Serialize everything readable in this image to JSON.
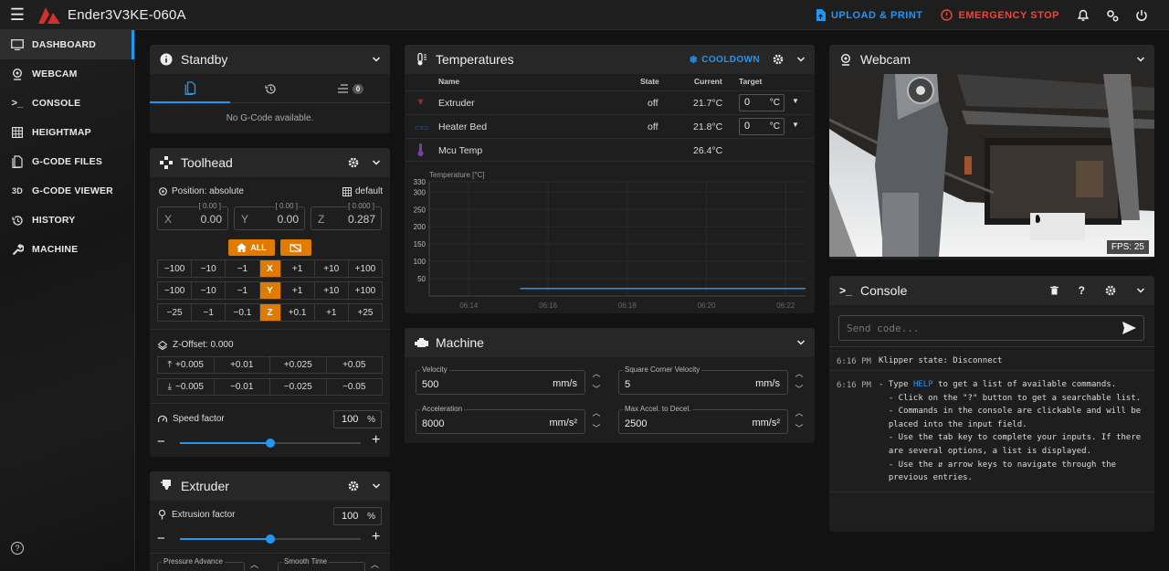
{
  "topbar": {
    "printer_name": "Ender3V3KE-060A",
    "upload_label": "UPLOAD & PRINT",
    "estop_label": "EMERGENCY STOP",
    "accent": "#2196f3",
    "danger": "#f44336"
  },
  "sidebar": {
    "items": [
      {
        "label": "DASHBOARD",
        "icon": "dashboard-icon"
      },
      {
        "label": "WEBCAM",
        "icon": "webcam-icon"
      },
      {
        "label": "CONSOLE",
        "icon": "console-icon"
      },
      {
        "label": "HEIGHTMAP",
        "icon": "grid-icon"
      },
      {
        "label": "G-CODE FILES",
        "icon": "file-icon"
      },
      {
        "label": "G-CODE VIEWER",
        "icon": "3d-icon"
      },
      {
        "label": "HISTORY",
        "icon": "history-icon"
      },
      {
        "label": "MACHINE",
        "icon": "wrench-icon"
      }
    ]
  },
  "standby": {
    "title": "Standby",
    "queue_count": "0",
    "empty_text": "No G-Code available."
  },
  "toolhead": {
    "title": "Toolhead",
    "position_label": "Position: absolute",
    "mesh_label": "default",
    "x": {
      "label": "X",
      "value": "0.00",
      "bracket": "[ 0.00 ]"
    },
    "y": {
      "label": "Y",
      "value": "0.00",
      "bracket": "[ 0.00 ]"
    },
    "z": {
      "label": "Z",
      "value": "0.287",
      "bracket": "[ 0.000 ]"
    },
    "home_all_label": "ALL",
    "x_row": [
      "−100",
      "−10",
      "−1",
      "X",
      "+1",
      "+10",
      "+100"
    ],
    "y_row": [
      "−100",
      "−10",
      "−1",
      "Y",
      "+1",
      "+10",
      "+100"
    ],
    "z_row": [
      "−25",
      "−1",
      "−0.1",
      "Z",
      "+0.1",
      "+1",
      "+25"
    ],
    "zoffset_label": "Z-Offset: 0.000",
    "zoff_up": [
      "+0.005",
      "+0.01",
      "+0.025",
      "+0.05"
    ],
    "zoff_down": [
      "−0.005",
      "−0.01",
      "−0.025",
      "−0.05"
    ],
    "speed_label": "Speed factor",
    "speed_value": "100",
    "speed_unit": "%",
    "speed_fraction": 0.5
  },
  "extruder": {
    "title": "Extruder",
    "factor_label": "Extrusion factor",
    "factor_value": "100",
    "factor_unit": "%",
    "factor_fraction": 0.5,
    "pressure_label": "Pressure Advance",
    "smooth_label": "Smooth Time"
  },
  "temperatures": {
    "title": "Temperatures",
    "cooldown_label": "COOLDOWN",
    "headers": {
      "name": "Name",
      "state": "State",
      "current": "Current",
      "target": "Target"
    },
    "rows": [
      {
        "name": "Extruder",
        "state": "off",
        "current": "21.7°C",
        "target": "0",
        "unit": "°C",
        "icon": "nozzle-icon"
      },
      {
        "name": "Heater Bed",
        "state": "off",
        "current": "21.8°C",
        "target": "0",
        "unit": "°C",
        "icon": "bed-icon"
      },
      {
        "name": "Mcu Temp",
        "state": "",
        "current": "26.4°C",
        "target": "",
        "unit": "",
        "icon": "thermometer-icon"
      }
    ]
  },
  "chart_data": {
    "type": "line",
    "title": "",
    "ylabel": "Temperature [°C]",
    "xlabel": "",
    "ylim": [
      0,
      330
    ],
    "yticks": [
      "330",
      "300",
      "250",
      "200",
      "150",
      "100",
      "50"
    ],
    "x": [
      "06:14",
      "06:16",
      "06:18",
      "06:20",
      "06:22"
    ],
    "series": [
      {
        "color": "#9c6ade",
        "x_start": "06:15.3",
        "values": [
          21.7,
          21.7
        ]
      },
      {
        "color": "#2196f3",
        "x_start": "06:15.3",
        "values": [
          21.8,
          21.8
        ]
      }
    ]
  },
  "machine": {
    "title": "Machine",
    "velocity_label": "Velocity",
    "velocity_value": "500",
    "velocity_unit": "mm/s",
    "scv_label": "Square Corner Velocity",
    "scv_value": "5",
    "scv_unit": "mm/s",
    "accel_label": "Acceleration",
    "accel_value": "8000",
    "accel_unit": "mm/s²",
    "decel_label": "Max Accel. to Decel.",
    "decel_value": "2500",
    "decel_unit": "mm/s²"
  },
  "webcam": {
    "title": "Webcam",
    "fps_label": "FPS: 25"
  },
  "console": {
    "title": "Console",
    "placeholder": "Send code...",
    "entries": [
      {
        "time": "6:16 PM",
        "lines": [
          "Klipper state: Disconnect"
        ]
      },
      {
        "time": "6:16 PM",
        "lines": [
          "- Type HELP to get a list of available commands.",
          "  - Click on the \"?\" button to get a searchable list.",
          "  - Commands in the console are clickable and will be",
          "  placed into the input field.",
          "  - Use the tab key to complete your inputs. If there",
          "  are several options, a list is displayed.",
          "  - Use the ⇵ arrow keys to navigate through the",
          "  previous entries."
        ]
      }
    ]
  }
}
